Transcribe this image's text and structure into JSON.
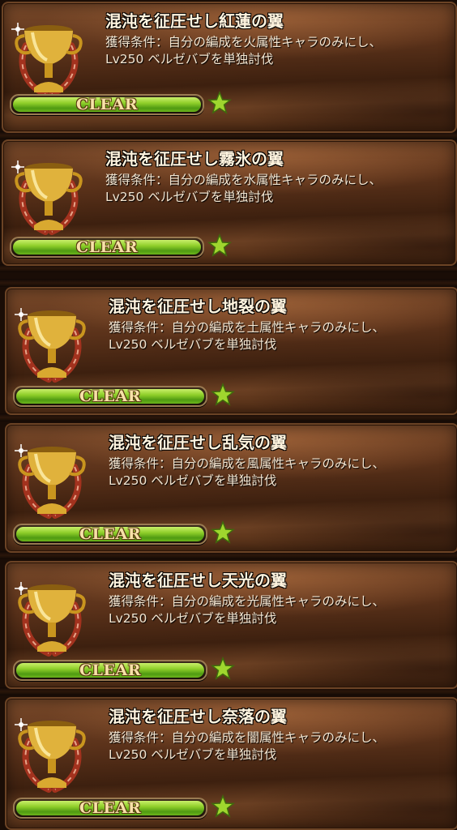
{
  "achievements": [
    {
      "title": "混沌を征圧せし紅蓮の翼",
      "condition_line1": "獲得条件：自分の編成を火属性キャラのみにし、",
      "condition_line2": "Lv250 ベルゼバブを単独討伐",
      "progress_label": "CLEAR",
      "progress": 1.0
    },
    {
      "title": "混沌を征圧せし霧氷の翼",
      "condition_line1": "獲得条件：自分の編成を水属性キャラのみにし、",
      "condition_line2": "Lv250 ベルゼバブを単独討伐",
      "progress_label": "CLEAR",
      "progress": 1.0
    },
    {
      "title": "混沌を征圧せし地裂の翼",
      "condition_line1": "獲得条件：自分の編成を土属性キャラのみにし、",
      "condition_line2": "Lv250 ベルゼバブを単独討伐",
      "progress_label": "CLEAR",
      "progress": 1.0
    },
    {
      "title": "混沌を征圧せし乱気の翼",
      "condition_line1": "獲得条件：自分の編成を風属性キャラのみにし、",
      "condition_line2": "Lv250 ベルゼバブを単独討伐",
      "progress_label": "CLEAR",
      "progress": 1.0
    },
    {
      "title": "混沌を征圧せし天光の翼",
      "condition_line1": "獲得条件：自分の編成を光属性キャラのみにし、",
      "condition_line2": "Lv250 ベルゼバブを単独討伐",
      "progress_label": "CLEAR",
      "progress": 1.0
    },
    {
      "title": "混沌を征圧せし奈落の翼",
      "condition_line1": "獲得条件：自分の編成を闇属性キャラのみにし、",
      "condition_line2": "Lv250 ベルゼバブを単独討伐",
      "progress_label": "CLEAR",
      "progress": 1.0
    }
  ],
  "icons": {
    "trophy": "gold-trophy-icon",
    "star": "star-icon"
  },
  "colors": {
    "bar_fill": "#8fcf2a",
    "star": "#9fd62e",
    "title": "#fff4df",
    "trophy_gold": "#e0b23c",
    "laurel": "#a3321e"
  }
}
